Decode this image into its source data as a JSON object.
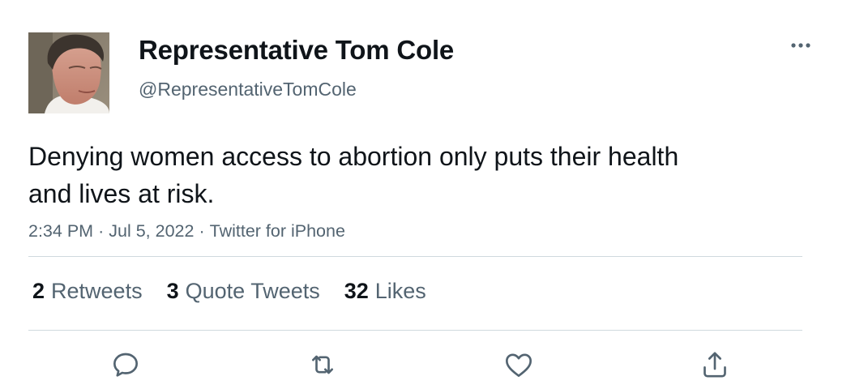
{
  "user": {
    "display_name": "Representative Tom Cole",
    "handle": "@RepresentativeTomCole",
    "avatar": "profile-photo"
  },
  "tweet": {
    "text": "Denying women access to abortion only puts their health and lives at risk.",
    "time": "2:34 PM",
    "date": "Jul 5, 2022",
    "source": "Twitter for iPhone",
    "separator": "·"
  },
  "stats": {
    "retweets_count": "2",
    "retweets_label": "Retweets",
    "quotes_count": "3",
    "quotes_label": "Quote Tweets",
    "likes_count": "32",
    "likes_label": "Likes"
  },
  "icons": {
    "more": "more-options-icon",
    "reply": "reply-icon",
    "retweet": "retweet-icon",
    "like": "like-icon",
    "share": "share-icon"
  },
  "colors": {
    "text_primary": "#0f1419",
    "text_secondary": "#536471",
    "divider": "#cfd9de"
  }
}
